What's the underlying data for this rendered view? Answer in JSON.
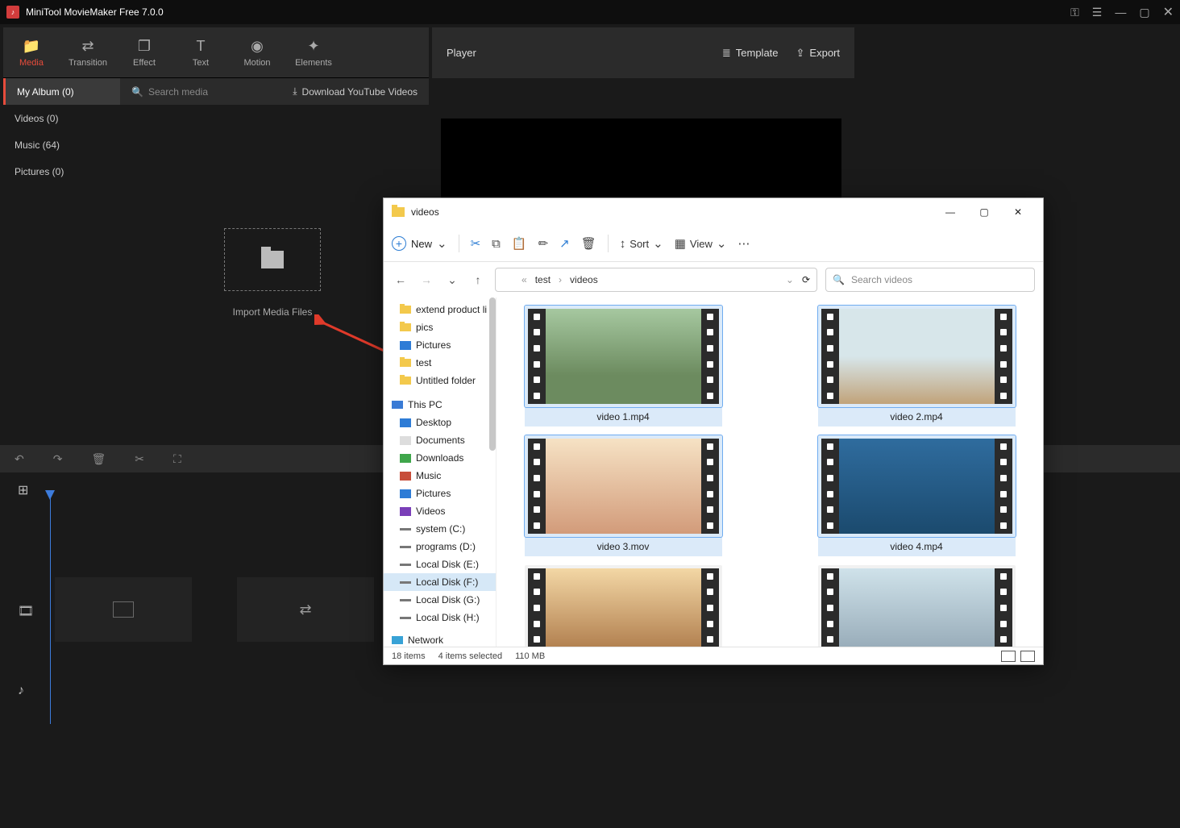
{
  "titlebar": {
    "app_name": "MiniTool MovieMaker Free 7.0.0"
  },
  "toolbar": {
    "media": "Media",
    "transition": "Transition",
    "effect": "Effect",
    "text": "Text",
    "motion": "Motion",
    "elements": "Elements"
  },
  "player": {
    "label": "Player",
    "template": "Template",
    "export": "Export"
  },
  "album": {
    "my_album": "My Album (0)",
    "videos": "Videos (0)",
    "music": "Music (64)",
    "pictures": "Pictures (0)"
  },
  "media_bar": {
    "search_placeholder": "Search media",
    "download": "Download YouTube Videos"
  },
  "dropzone": {
    "label": "Import Media Files"
  },
  "explorer": {
    "folder": "videos",
    "cmd": {
      "new": "New",
      "sort": "Sort",
      "view": "View"
    },
    "breadcrumb": {
      "test": "test",
      "videos": "videos"
    },
    "search_placeholder": "Search videos",
    "tree": {
      "extend": "extend product li",
      "pics": "pics",
      "picturesTop": "Pictures",
      "test": "test",
      "untitled": "Untitled folder",
      "thispc": "This PC",
      "desktop": "Desktop",
      "documents": "Documents",
      "downloads": "Downloads",
      "music": "Music",
      "pictures": "Pictures",
      "videos": "Videos",
      "system": "system (C:)",
      "programs": "programs (D:)",
      "lde": "Local Disk (E:)",
      "ldf": "Local Disk (F:)",
      "ldg": "Local Disk (G:)",
      "ldh": "Local Disk (H:)",
      "network": "Network"
    },
    "files": {
      "v1": "video 1.mp4",
      "v2": "video 2.mp4",
      "v3": "video 3.mov",
      "v4": "video 4.mp4"
    },
    "status": {
      "items": "18 items",
      "selected": "4 items selected",
      "size": "110 MB"
    }
  }
}
